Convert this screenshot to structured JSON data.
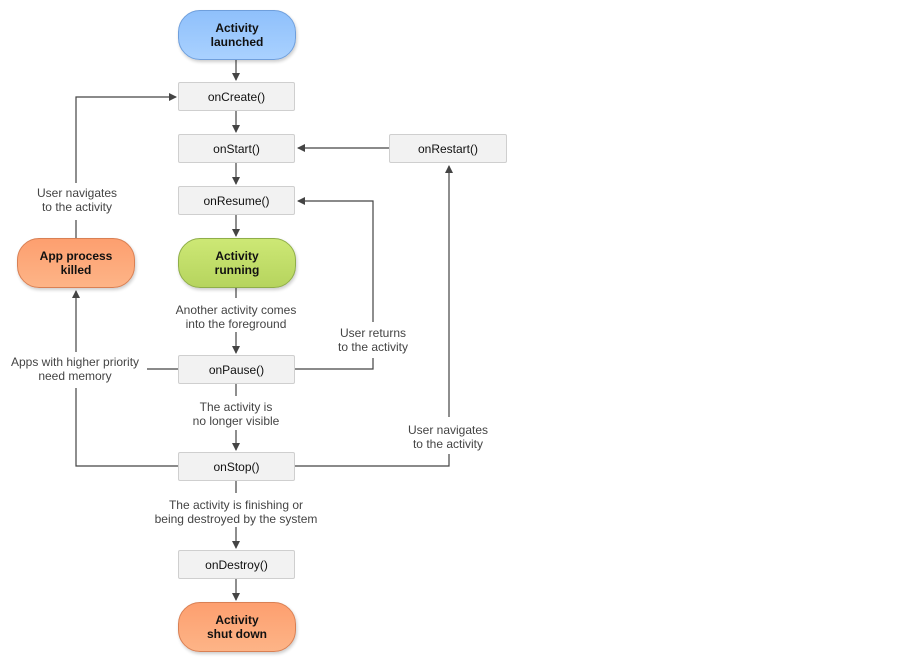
{
  "nodes": {
    "launched": "Activity\nlaunched",
    "on_create": "onCreate()",
    "on_start": "onStart()",
    "on_restart": "onRestart()",
    "on_resume": "onResume()",
    "running": "Activity\nrunning",
    "process_killed": "App process\nkilled",
    "on_pause": "onPause()",
    "on_stop": "onStop()",
    "on_destroy": "onDestroy()",
    "shut_down": "Activity\nshut down"
  },
  "labels": {
    "user_navigates_left": "User navigates\nto the activity",
    "another_activity": "Another activity comes\ninto the foreground",
    "user_returns": "User returns\nto the activity",
    "higher_priority": "Apps with higher priority\nneed memory",
    "no_longer_visible": "The activity is\nno longer visible",
    "user_navigates_right": "User navigates\nto the activity",
    "finishing": "The activity is finishing or\nbeing destroyed by the system"
  },
  "colors": {
    "start": "#a9d1ff",
    "running": "#c3df69",
    "end": "#fdaa7c",
    "box": "#f2f2f2",
    "line": "#444444"
  }
}
